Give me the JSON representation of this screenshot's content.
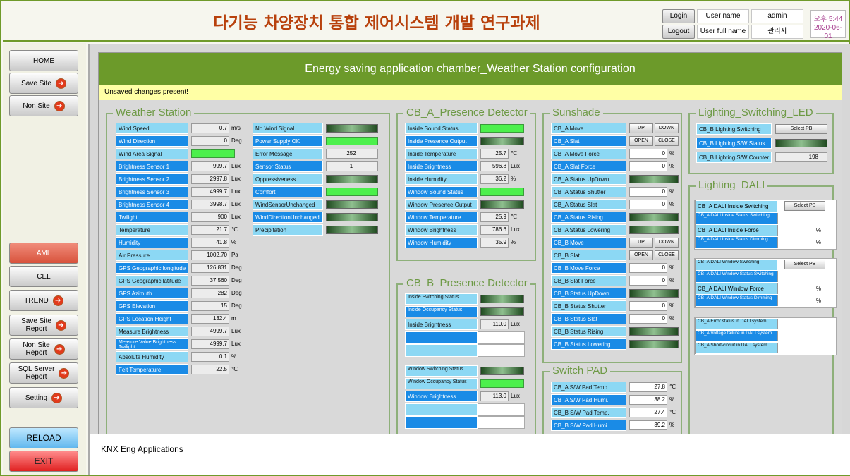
{
  "header": {
    "title": "다기능 차양장치 통합 제어시스템 개발 연구과제",
    "login_label": "Login",
    "logout_label": "Logout",
    "user_name_label": "User name",
    "user_full_name_label": "User full name",
    "user_name_value": "admin",
    "user_full_name_value": "관리자",
    "clock_time": "오후 5:44",
    "clock_date": "2020-06-01"
  },
  "sidebar": {
    "home": "HOME",
    "save_site": "Save Site",
    "non_site": "Non Site",
    "aml": "AML",
    "cel": "CEL",
    "trend": "TREND",
    "save_site_report_1": "Save Site",
    "save_site_report_2": "Report",
    "non_site_report_1": "Non Site",
    "non_site_report_2": "Report",
    "sql_report_1": "SQL Server",
    "sql_report_2": "Report",
    "setting": "Setting",
    "reload": "RELOAD",
    "exit": "EXIT"
  },
  "panel": {
    "title": "Energy saving application chamber_Weather Station configuration",
    "unsaved": "Unsaved changes present!"
  },
  "weather": {
    "title": "Weather Station",
    "rows": [
      {
        "label": "Wind Speed",
        "value": "0.7",
        "unit": "m/s"
      },
      {
        "label": "Wind Direction",
        "value": "0",
        "unit": "Deg"
      },
      {
        "label": "Wind Area Signal",
        "value": "",
        "unit": ""
      },
      {
        "label": "Brightness Sensor 1",
        "value": "999.7",
        "unit": "Lux"
      },
      {
        "label": "Brightness Sensor 2",
        "value": "2997.8",
        "unit": "Lux"
      },
      {
        "label": "Brightness Sensor 3",
        "value": "4999.7",
        "unit": "Lux"
      },
      {
        "label": "Brightness Sensor 4",
        "value": "3998.7",
        "unit": "Lux"
      },
      {
        "label": "Twilight",
        "value": "900",
        "unit": "Lux"
      },
      {
        "label": "Temperature",
        "value": "21.7",
        "unit": "℃"
      },
      {
        "label": "Humidity",
        "value": "41.8",
        "unit": "%"
      },
      {
        "label": "Air Pressure",
        "value": "1002.70",
        "unit": "Pa"
      },
      {
        "label": "GPS Geographic longitude",
        "value": "126.831",
        "unit": "Deg"
      },
      {
        "label": "GPS Geographic latitude",
        "value": "37.560",
        "unit": "Deg"
      },
      {
        "label": "GPS Azimuth",
        "value": "282",
        "unit": "Deg"
      },
      {
        "label": "GPS Elevation",
        "value": "15",
        "unit": "Deg"
      },
      {
        "label": "GPS Location Height",
        "value": "132.4",
        "unit": "m"
      },
      {
        "label": "Measure Brightness",
        "value": "4999.7",
        "unit": "Lux"
      },
      {
        "label": "Measure Value Brightness Twilight",
        "value": "4999.7",
        "unit": "Lux"
      },
      {
        "label": "Absolute Humidity",
        "value": "0.1",
        "unit": "%"
      },
      {
        "label": "Felt Temperature",
        "value": "22.5",
        "unit": "℃"
      }
    ],
    "status": [
      {
        "label": "No Wind Signal",
        "value": ""
      },
      {
        "label": "Power Supply OK",
        "value": ""
      },
      {
        "label": "Error Message",
        "value": "252"
      },
      {
        "label": "Sensor Status",
        "value": "1"
      },
      {
        "label": "Oppressiveness",
        "value": ""
      },
      {
        "label": "Comfort",
        "value": ""
      },
      {
        "label": "WindSensorUnchanged",
        "value": ""
      },
      {
        "label": "WindDirectionUnchanged",
        "value": ""
      },
      {
        "label": "Precipitation",
        "value": ""
      }
    ]
  },
  "presence_a": {
    "title": "CB_A_Presence Detector",
    "rows": [
      {
        "label": "Inside Sound Status",
        "value": "",
        "unit": ""
      },
      {
        "label": "Inside Presence Output",
        "value": "",
        "unit": ""
      },
      {
        "label": "Inside Temperature",
        "value": "25.7",
        "unit": "℃"
      },
      {
        "label": "Inside Brightness",
        "value": "596.8",
        "unit": "Lux"
      },
      {
        "label": "Inside Humidity",
        "value": "36.2",
        "unit": "%"
      },
      {
        "label": "Window Sound Status",
        "value": "",
        "unit": ""
      },
      {
        "label": "Window Presence Output",
        "value": "",
        "unit": ""
      },
      {
        "label": "Window Temperature",
        "value": "25.9",
        "unit": "℃"
      },
      {
        "label": "Window Brightness",
        "value": "786.6",
        "unit": "Lux"
      },
      {
        "label": "Window Humidity",
        "value": "35.9",
        "unit": "%"
      }
    ]
  },
  "presence_b": {
    "title": "CB_B_Presence Detector",
    "rows": [
      {
        "label": "Inside Switching Status",
        "value": "",
        "unit": ""
      },
      {
        "label": "Inside Occupancy Status",
        "value": "",
        "unit": ""
      },
      {
        "label": "Inside Brightness",
        "value": "110.0",
        "unit": "Lux"
      },
      {
        "label": "Window Switching Status",
        "value": "",
        "unit": ""
      },
      {
        "label": "Window Occupancy Status",
        "value": "",
        "unit": ""
      },
      {
        "label": "Window Brightness",
        "value": "113.0",
        "unit": "Lux"
      }
    ]
  },
  "sunshade": {
    "title": "Sunshade",
    "up": "UP",
    "down": "DOWN",
    "open": "OPEN",
    "close": "CLOSE",
    "rows": [
      {
        "label": "CB_A Move",
        "value": "",
        "unit": ""
      },
      {
        "label": "CB_A Slat",
        "value": "",
        "unit": ""
      },
      {
        "label": "CB_A Move Force",
        "value": "0",
        "unit": "%"
      },
      {
        "label": "CB_A Slat Force",
        "value": "0",
        "unit": "%"
      },
      {
        "label": "CB_A Status UpDown",
        "value": "",
        "unit": ""
      },
      {
        "label": "CB_A Status Shutter",
        "value": "0",
        "unit": "%"
      },
      {
        "label": "CB_A Status Slat",
        "value": "0",
        "unit": "%"
      },
      {
        "label": "CB_A Status Rising",
        "value": "",
        "unit": ""
      },
      {
        "label": "CB_A Status Lowering",
        "value": "",
        "unit": ""
      },
      {
        "label": "CB_B Move",
        "value": "",
        "unit": ""
      },
      {
        "label": "CB_B Slat",
        "value": "",
        "unit": ""
      },
      {
        "label": "CB_B Move Force",
        "value": "0",
        "unit": "%"
      },
      {
        "label": "CB_B Slat Force",
        "value": "0",
        "unit": "%"
      },
      {
        "label": "CB_B Status UpDown",
        "value": "",
        "unit": ""
      },
      {
        "label": "CB_B Status Shutter",
        "value": "0",
        "unit": "%"
      },
      {
        "label": "CB_B Status Slat",
        "value": "0",
        "unit": "%"
      },
      {
        "label": "CB_B Status Rising",
        "value": "",
        "unit": ""
      },
      {
        "label": "CB_B Status Lowering",
        "value": "",
        "unit": ""
      }
    ]
  },
  "switchpad": {
    "title": "Switch PAD",
    "rows": [
      {
        "label": "CB_A S/W Pad Temp.",
        "value": "27.8",
        "unit": "℃"
      },
      {
        "label": "CB_A S/W Pad Humi.",
        "value": "38.2",
        "unit": "%"
      },
      {
        "label": "CB_B S/W Pad Temp.",
        "value": "27.4",
        "unit": "℃"
      },
      {
        "label": "CB_B S/W Pad Humi.",
        "value": "39.2",
        "unit": "%"
      }
    ]
  },
  "lighting_led": {
    "title": "Lighting_Switching_LED",
    "switching": "CB_B Lighting Switching",
    "select_pb": "Select PB",
    "sw_status": "CB_B Lighting S/W Status",
    "sw_counter": "CB_B Lighting S/W Counter",
    "counter_value": "198"
  },
  "lighting_dali": {
    "title": "Lighting_DALI",
    "select_pb": "Select PB",
    "inside_switching": "CB_A DALI Inside Switching",
    "inside_status_switching": "CB_A DALI Inside Status Switching",
    "inside_force": "CB_A DALI Inside Force",
    "inside_force_unit": "%",
    "inside_status_dimming": "CB_A DALI Inside Status Dimming",
    "inside_dimming_unit": "%",
    "window_switching": "CB_A DALI Window Switching",
    "window_status_switching": "CB_A DALI Window Status Switching",
    "window_force": "CB_A DALI Window Force",
    "window_force_unit": "%",
    "window_status_dimming": "CB_A DALI Window Status Dimming",
    "window_dimming_unit": "%",
    "error_status": "CB_A Error status in DALI system",
    "voltage_failure": "CB_A Voltage failure in DALI system",
    "short_circuit": "CB_A Short-circuit in DALI system"
  },
  "footer": {
    "text": "KNX Eng Applications"
  },
  "colors": {
    "accent_green": "#6c9a2a",
    "title_red": "#b8410c",
    "label_blue": "#1a8be6",
    "label_cyan": "#8cd8f4",
    "led_on": "#4cf04c"
  }
}
